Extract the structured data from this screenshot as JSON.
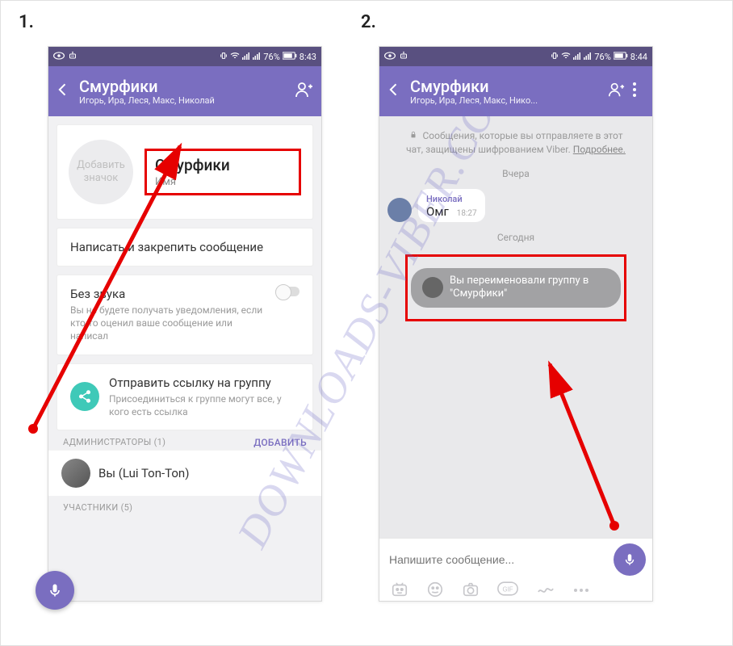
{
  "labels": {
    "one": "1.",
    "two": "2."
  },
  "status": {
    "battery_pct": "76%",
    "time_left": "8:43",
    "time_right": "8:44"
  },
  "header": {
    "title": "Смурфики",
    "participants_full": "Игорь, Ира, Леся, Макс, Николай",
    "participants_trunc": "Игорь, Ира, Леся, Макс, Нико..."
  },
  "settings": {
    "add_icon": "Добавить значок",
    "name": "Смурфики",
    "name_sub": "Имя",
    "pin_msg": "Написать и закрепить сообщение",
    "mute_title": "Без звука",
    "mute_sub": "Вы не будете получать уведомления, если кто-то оценил ваше сообщение или написал",
    "share_title": "Отправить ссылку на группу",
    "share_sub": "Присоединиться к группе могут все, у кого есть ссылка",
    "admins_label": "АДМИНИСТРАТОРЫ (1)",
    "admins_add": "ДОБАВИТЬ",
    "admin_name": "Вы (Lui Ton-Ton)",
    "members_label": "УЧАСТНИКИ (5)"
  },
  "chat": {
    "encrypt": "Сообщения, которые вы отправляете в этот чат, защищены шифрованием Viber.",
    "encrypt_more": "Подробнее.",
    "day_yesterday": "Вчера",
    "msg1_sender": "Николай",
    "msg1_text": "Омг",
    "msg1_time": "18:27",
    "day_today": "Сегодня",
    "system_msg": "Вы переименовали группу в \"Смурфики\"",
    "input_placeholder": "Напишите сообщение..."
  },
  "watermark": "DOWNLOADS-VIBER.CO"
}
